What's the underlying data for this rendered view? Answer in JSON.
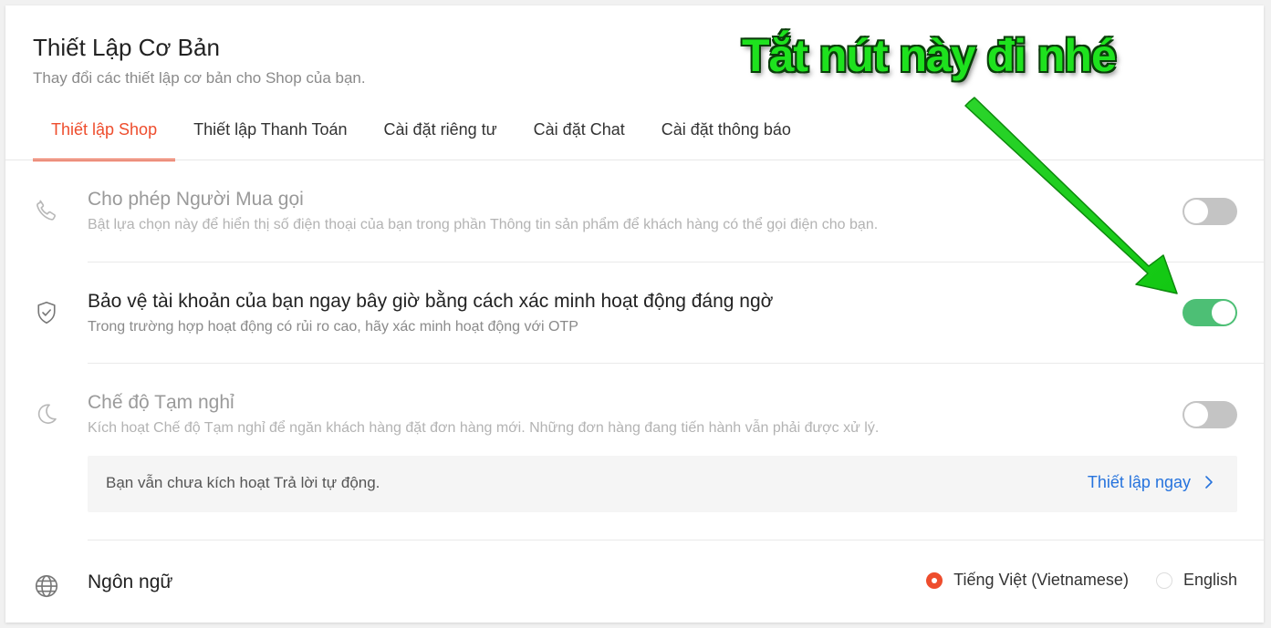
{
  "header": {
    "title": "Thiết Lập Cơ Bản",
    "subtitle": "Thay đổi các thiết lập cơ bản cho Shop của bạn."
  },
  "tabs": [
    {
      "label": "Thiết lập Shop",
      "active": true
    },
    {
      "label": "Thiết lập Thanh Toán",
      "active": false
    },
    {
      "label": "Cài đặt riêng tư",
      "active": false
    },
    {
      "label": "Cài đặt Chat",
      "active": false
    },
    {
      "label": "Cài đặt thông báo",
      "active": false
    }
  ],
  "settings": {
    "call": {
      "icon": "phone-icon",
      "title": "Cho phép Người Mua gọi",
      "description": "Bật lựa chọn này để hiển thị số điện thoại của bạn trong phần Thông tin sản phẩm để khách hàng có thể gọi điện cho bạn.",
      "enabled": false
    },
    "protect": {
      "icon": "shield-check-icon",
      "title": "Bảo vệ tài khoản của bạn ngay bây giờ bằng cách xác minh hoạt động đáng ngờ",
      "description": "Trong trường hợp hoạt động có rủi ro cao, hãy xác minh hoạt động với OTP",
      "enabled": true
    },
    "vacation": {
      "icon": "moon-icon",
      "title": "Chế độ Tạm nghỉ",
      "description": "Kích hoạt Chế độ Tạm nghỉ để ngăn khách hàng đặt đơn hàng mới. Những đơn hàng đang tiến hành vẫn phải được xử lý.",
      "enabled": false,
      "banner": {
        "text": "Bạn vẫn chưa kích hoạt Trả lời tự động.",
        "link_label": "Thiết lập ngay"
      }
    },
    "language": {
      "icon": "globe-icon",
      "title": "Ngôn ngữ",
      "options": [
        {
          "label": "Tiếng Việt (Vietnamese)",
          "selected": true
        },
        {
          "label": "English",
          "selected": false
        }
      ]
    }
  },
  "annotation": {
    "text": "Tắt nút này đi nhé",
    "color": "#1ee21e"
  },
  "colors": {
    "accent": "#ee4d2d",
    "toggle_on": "#4dbf75",
    "link": "#2673dd"
  }
}
